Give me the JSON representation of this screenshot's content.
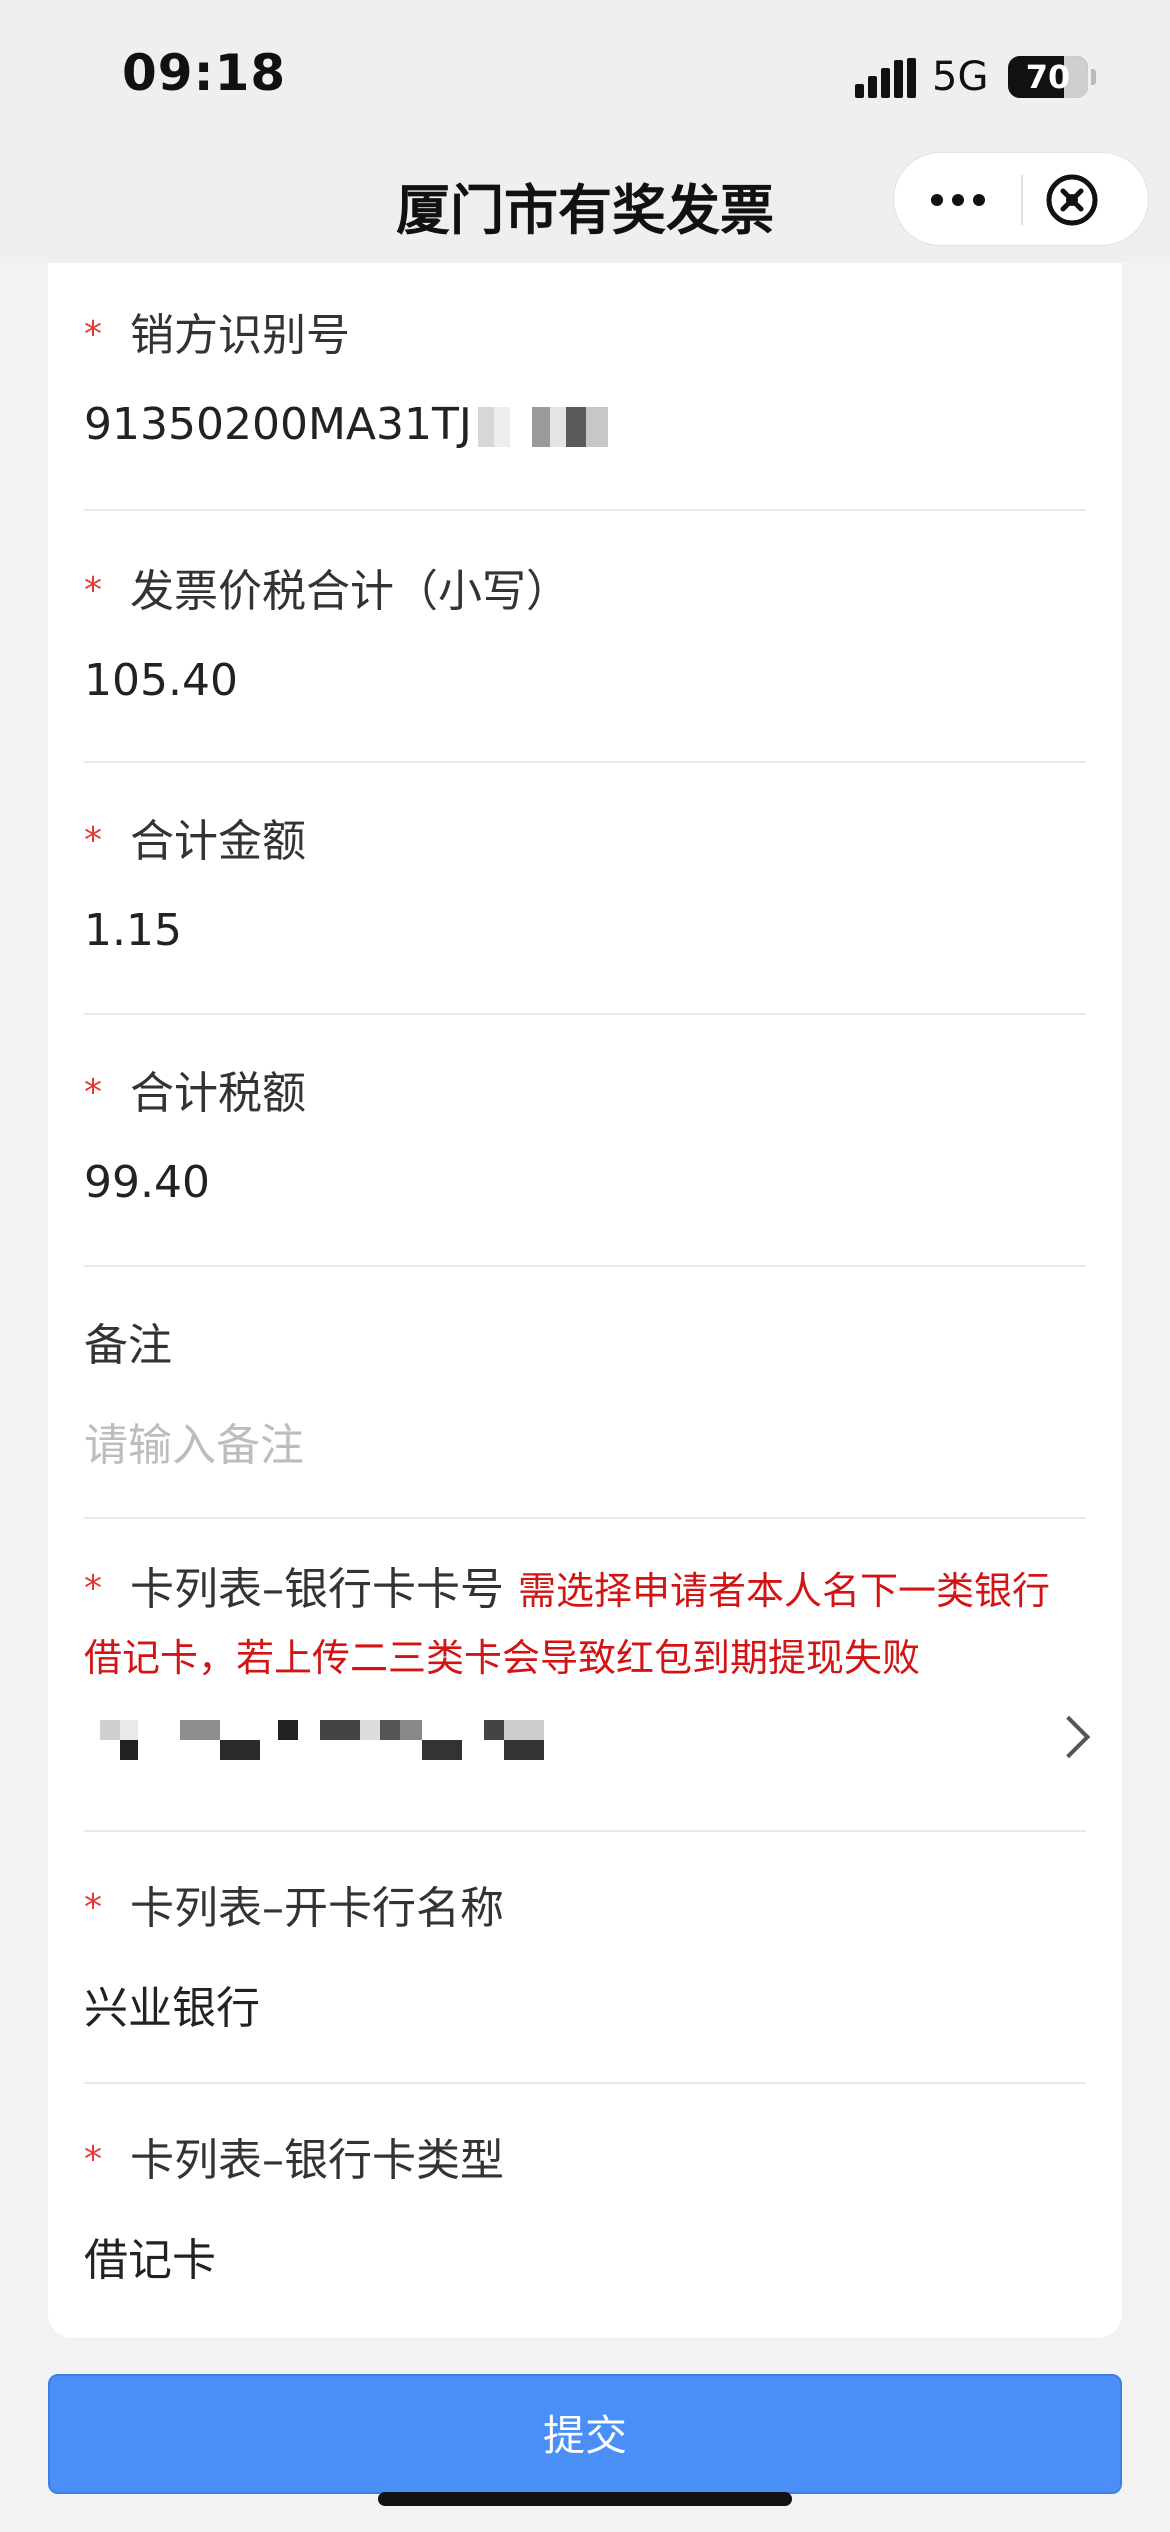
{
  "status_bar": {
    "time": "09:18",
    "network": "5G",
    "battery": "70"
  },
  "nav": {
    "title": "厦门市有奖发票",
    "more_icon": "more-dots-icon",
    "close_icon": "close-circle-icon"
  },
  "form": {
    "seller_id": {
      "label": "销方识别号",
      "value": "91350200MA31TJ",
      "required": true
    },
    "total_with_tax": {
      "label": "发票价税合计（小写）",
      "value": "105.40",
      "required": true
    },
    "total_amount": {
      "label": "合计金额",
      "value": "1.15",
      "required": true
    },
    "total_tax": {
      "label": "合计税额",
      "value": "99.40",
      "required": true
    },
    "remark": {
      "label": "备注",
      "placeholder": "请输入备注",
      "required": false
    },
    "card_number": {
      "label": "卡列表–银行卡卡号",
      "hint": "需选择申请者本人名下一类银行借记卡，若上传二三类卡会导致红包到期提现失败",
      "required": true
    },
    "bank_name": {
      "label": "卡列表–开卡行名称",
      "value": "兴业银行",
      "required": true
    },
    "card_type": {
      "label": "卡列表–银行卡类型",
      "value": "借记卡",
      "required": true
    },
    "required_mark": "*"
  },
  "submit_label": "提交",
  "colors": {
    "accent": "#4a8ef8",
    "required": "#e53935",
    "warning": "#d21414"
  }
}
